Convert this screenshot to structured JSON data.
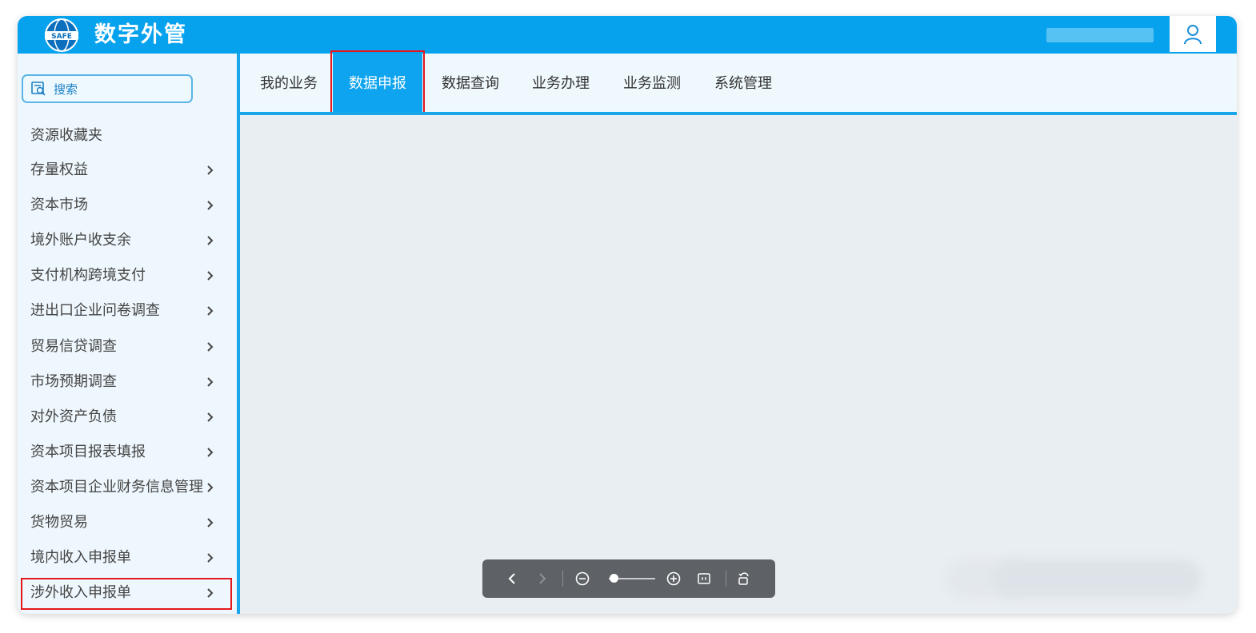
{
  "app": {
    "title": "数字外管",
    "logo_text": "SAFE"
  },
  "search": {
    "label": "搜索"
  },
  "sidebar": {
    "items": [
      {
        "label": "资源收藏夹",
        "has_arrow": false
      },
      {
        "label": "存量权益",
        "has_arrow": true
      },
      {
        "label": "资本市场",
        "has_arrow": true
      },
      {
        "label": "境外账户收支余",
        "has_arrow": true
      },
      {
        "label": "支付机构跨境支付",
        "has_arrow": true
      },
      {
        "label": "进出口企业问卷调查",
        "has_arrow": true
      },
      {
        "label": "贸易信贷调查",
        "has_arrow": true
      },
      {
        "label": "市场预期调查",
        "has_arrow": true
      },
      {
        "label": "对外资产负债",
        "has_arrow": true
      },
      {
        "label": "资本项目报表填报",
        "has_arrow": true
      },
      {
        "label": "资本项目企业财务信息管理",
        "has_arrow": true
      },
      {
        "label": "货物贸易",
        "has_arrow": true
      },
      {
        "label": "境内收入申报单",
        "has_arrow": true
      },
      {
        "label": "涉外收入申报单",
        "has_arrow": true,
        "highlighted": true
      }
    ]
  },
  "tabs": [
    {
      "label": "我的业务",
      "active": false
    },
    {
      "label": "数据申报",
      "active": true,
      "highlighted": true
    },
    {
      "label": "数据查询",
      "active": false
    },
    {
      "label": "业务办理",
      "active": false
    },
    {
      "label": "业务监测",
      "active": false
    },
    {
      "label": "系统管理",
      "active": false
    }
  ],
  "viewer_toolbar": {
    "icons": [
      "chevron-left-icon",
      "chevron-right-icon",
      "zoom-out-icon",
      "zoom-slider",
      "zoom-in-icon",
      "fit-page-icon",
      "rotate-icon"
    ]
  },
  "colors": {
    "topbar": "#07a2ee",
    "active_tab": "#0ea4ef",
    "highlight_border": "#e5171e",
    "sidebar_bg": "#eef7fd",
    "content_bg": "#e9eef2"
  }
}
